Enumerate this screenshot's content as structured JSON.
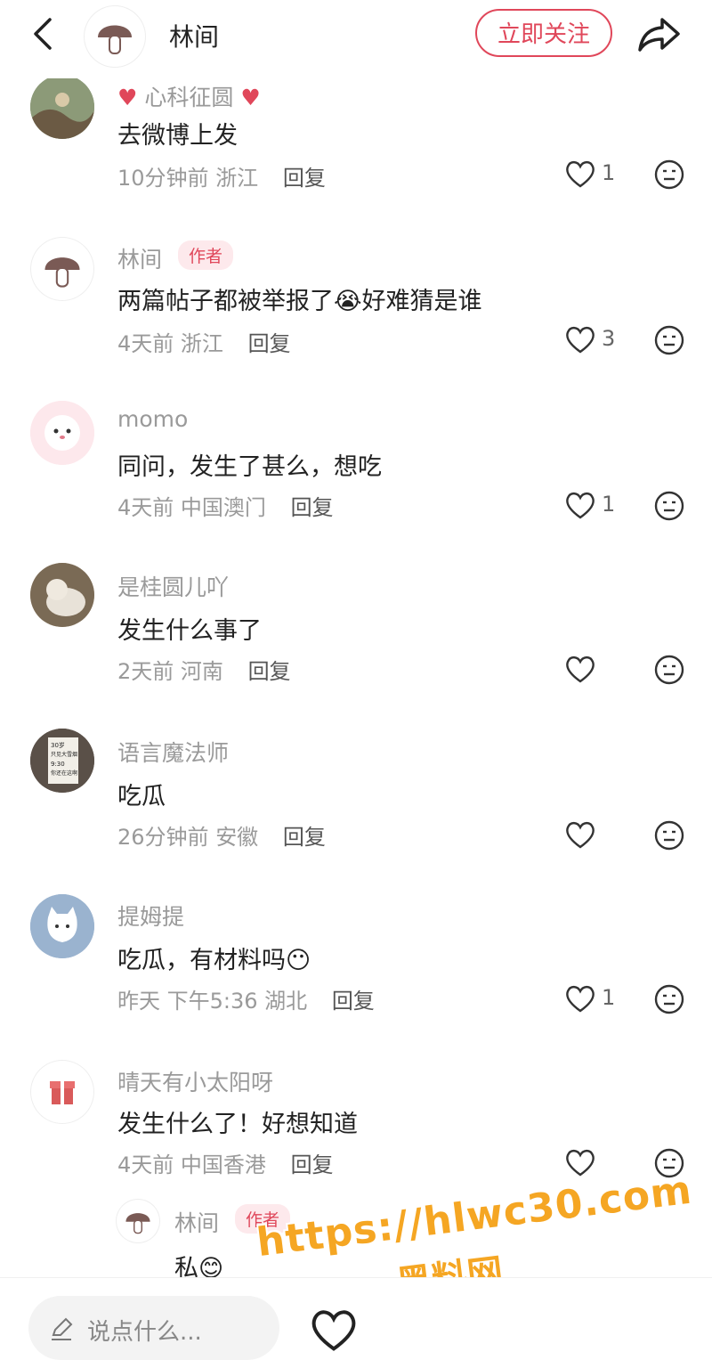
{
  "header": {
    "title": "林间",
    "follow_label": "立即关注"
  },
  "comments": [
    {
      "badge_line": "心科征圆",
      "text": "去微博上发",
      "time": "10分钟前",
      "location": "浙江",
      "reply": "回复",
      "likes": "1"
    },
    {
      "name": "林间",
      "author_badge": "作者",
      "text": "两篇帖子都被举报了😭好难猜是谁",
      "time": "4天前",
      "location": "浙江",
      "reply": "回复",
      "likes": "3"
    },
    {
      "name": "momo",
      "text": "同问，发生了甚么，想吃",
      "time": "4天前",
      "location": "中国澳门",
      "reply": "回复",
      "likes": "1"
    },
    {
      "name": "是桂圆儿吖",
      "text": "发生什么事了",
      "time": "2天前",
      "location": "河南",
      "reply": "回复",
      "likes": ""
    },
    {
      "name": "语言魔法师",
      "text": "吃瓜",
      "time": "26分钟前",
      "location": "安徽",
      "reply": "回复",
      "likes": ""
    },
    {
      "name": "提姆提",
      "text": "吃瓜，有材料吗😶",
      "time": "昨天 下午5:36",
      "location": "湖北",
      "reply": "回复",
      "likes": "1"
    },
    {
      "name": "晴天有小太阳呀",
      "text": "发生什么了！好想知道",
      "time": "4天前",
      "location": "中国香港",
      "reply": "回复",
      "likes": ""
    }
  ],
  "sub_reply": {
    "name": "林间",
    "author_badge": "作者",
    "text": "私😊"
  },
  "avatar_text": {
    "line1": "30岁",
    "line2": "只见大雪烟",
    "line3": "9:30",
    "line4": "你还在这啊"
  },
  "bottom": {
    "input_placeholder": "说点什么..."
  },
  "watermark": {
    "url": "https://hlwc30.com",
    "name": "黑料网"
  },
  "colors": {
    "accent": "#e0475a",
    "watermark": "#f5a623"
  }
}
